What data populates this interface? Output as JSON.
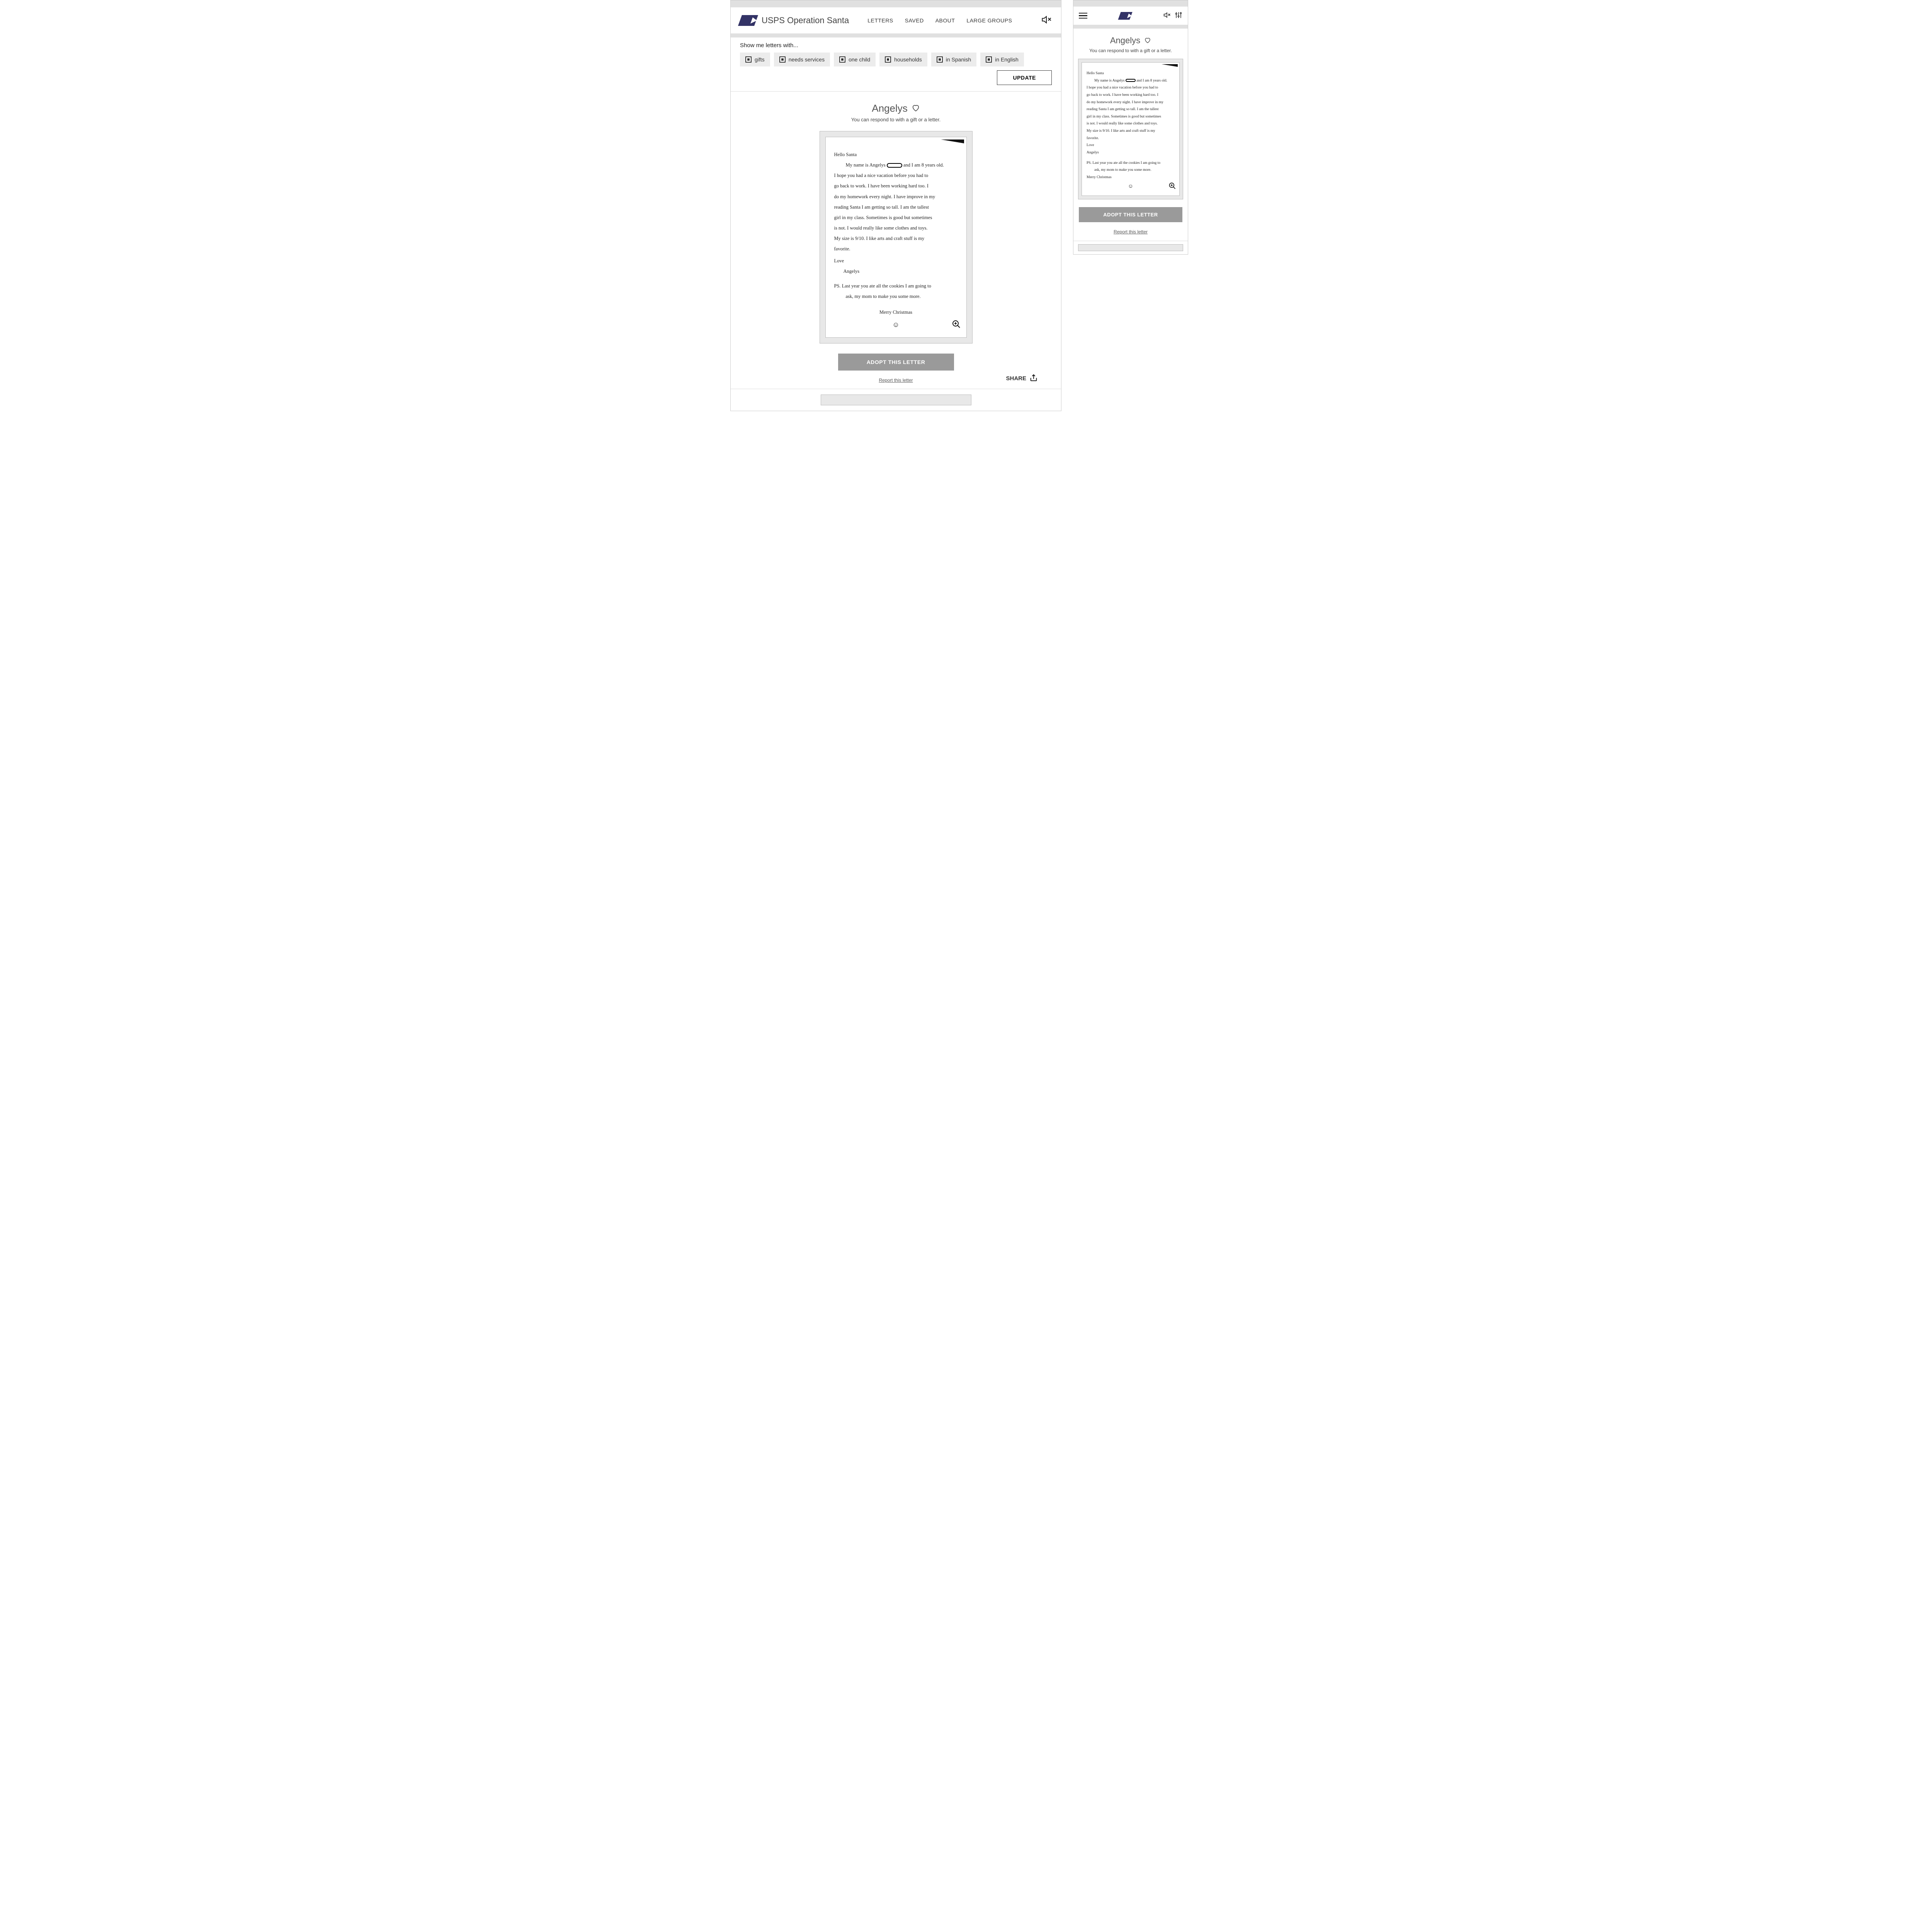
{
  "brand": "USPS Operation Santa",
  "nav": {
    "letters": "LETTERS",
    "saved": "SAVED",
    "about": "ABOUT",
    "large_groups": "LARGE GROUPS"
  },
  "filter": {
    "label": "Show me letters with...",
    "gifts": "gifts",
    "needs_services": "needs services",
    "one_child": "one child",
    "households": "households",
    "in_spanish": "in Spanish",
    "in_english": "in English",
    "update": "UPDATE"
  },
  "letter": {
    "title": "Angelys",
    "subtitle": "You can respond to with a gift or a letter.",
    "greeting": "Hello Santa",
    "body_intro_1": "My name is Angelys",
    "body_intro_2": "and I am 8 years old.",
    "body_2": "I hope you had a nice vacation before you had to",
    "body_3": "go back to work. I have been working hard too. I",
    "body_4": "do my homework every night. I have improve in my",
    "body_5": "reading Santa I am getting so tall. I am the tallest",
    "body_6": "girl in my class. Sometimes is good but sometimes",
    "body_7": "is not. I would really like some clothes and toys.",
    "body_8": "My size is 9/10. I like arts and craft stuff is my",
    "body_9": "favorite.",
    "sign_love": "Love",
    "sign_name": "Angelys",
    "ps_1": "PS. Last year you ate all the cookies I am going to",
    "ps_2": "ask, my mom to make you some more.",
    "merry": "Merry Christmas"
  },
  "actions": {
    "adopt": "ADOPT THIS LETTER",
    "report": "Report this letter",
    "share": "SHARE"
  }
}
